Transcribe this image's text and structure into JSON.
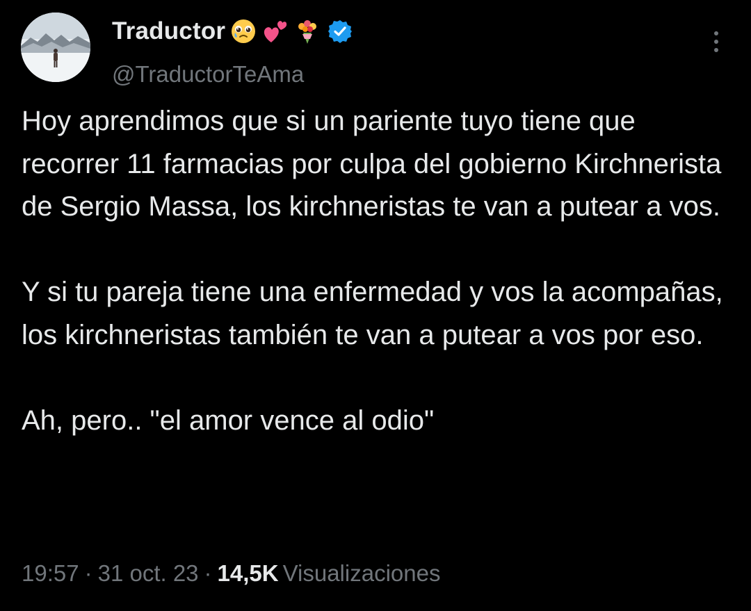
{
  "author": {
    "display_name": "Traductor",
    "handle": "@TraductorTeAma",
    "emojis": [
      "pleading-face-icon",
      "two-hearts-icon",
      "bouquet-icon"
    ],
    "verified_icon": "verified-badge-icon",
    "verified_color": "#1d9bf0"
  },
  "menu": {
    "icon": "more-vertical-icon"
  },
  "tweet": {
    "paragraphs": [
      "Hoy aprendimos que si un pariente tuyo tiene que recorrer 11 farmacias por culpa del gobierno Kirchnerista de Sergio Massa, los kirchneristas te van a putear a vos.",
      "Y si tu pareja tiene una enfermedad y vos la acompañas, los kirchneristas también te van a putear a vos por eso.",
      "Ah, pero.. \"el amor vence al odio\""
    ]
  },
  "meta": {
    "time": "19:57",
    "separator": "·",
    "date": "31 oct. 23",
    "views_count": "14,5K",
    "views_label": "Visualizaciones"
  },
  "colors": {
    "background": "#000000",
    "text_primary": "#e7e9ea",
    "text_secondary": "#71767b"
  }
}
